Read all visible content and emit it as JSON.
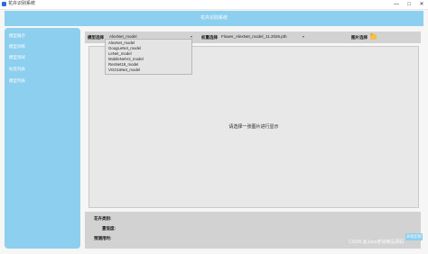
{
  "window": {
    "title": "花卉识别系统",
    "controls": [
      "—",
      "□",
      "✕"
    ]
  },
  "header": {
    "title": "花卉识别系统"
  },
  "sidebar": {
    "items": [
      {
        "label": "模型展示"
      },
      {
        "label": "模型训练"
      },
      {
        "label": "模型测试"
      },
      {
        "label": "标签列表"
      },
      {
        "label": "模型列表"
      }
    ]
  },
  "toolbar": {
    "model_label": "模型选择",
    "model_value": "AlexNet_model",
    "weight_label": "权重选择",
    "weight_value": "Flower_AlexNet_model_11.2026.pth",
    "image_label": "图片选择",
    "folder_icon": "folder-icon"
  },
  "dropdown": {
    "options": [
      "AlexNet_model",
      "GoogLeNet_model",
      "LeNet_model",
      "MobileNetV2_model",
      "ResNet18_model",
      "VGG16Net_model"
    ]
  },
  "image_area": {
    "placeholder": "请选择一张图片进行显示"
  },
  "results": {
    "name_label": "花卉类别:",
    "confidence_label": "置信度:",
    "time_label": "预测用时:"
  },
  "start_button": {
    "label": "开始识别"
  },
  "watermark": "CSDN @Java老徐精品源码",
  "colors": {
    "accent": "#8ccfee",
    "panel": "#d2d2d2",
    "image_bg": "#e8e8e8",
    "background": "#f6f6f6"
  }
}
